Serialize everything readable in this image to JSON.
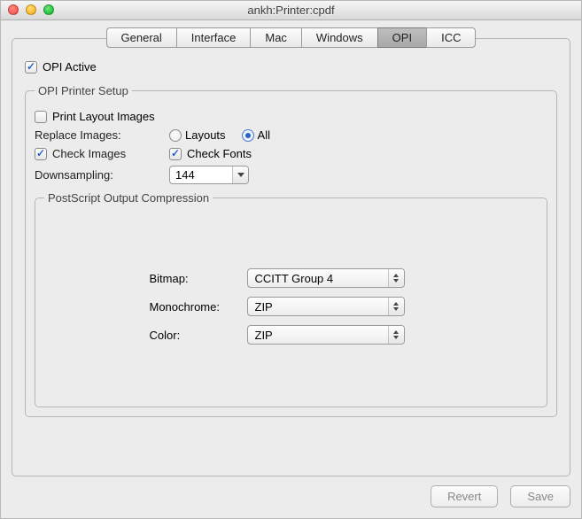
{
  "window": {
    "title": "ankh:Printer:cpdf"
  },
  "tabs": [
    {
      "label": "General",
      "active": false
    },
    {
      "label": "Interface",
      "active": false
    },
    {
      "label": "Mac",
      "active": false
    },
    {
      "label": "Windows",
      "active": false
    },
    {
      "label": "OPI",
      "active": true
    },
    {
      "label": "ICC",
      "active": false
    }
  ],
  "opi": {
    "active_label": "OPI Active",
    "active_checked": true,
    "setup_legend": "OPI Printer Setup",
    "print_layout_images_label": "Print Layout Images",
    "print_layout_images_checked": false,
    "replace_images_label": "Replace Images:",
    "replace_layouts_label": "Layouts",
    "replace_all_label": "All",
    "replace_selected": "all",
    "check_images_label": "Check Images",
    "check_images_checked": true,
    "check_fonts_label": "Check Fonts",
    "check_fonts_checked": true,
    "downsampling_label": "Downsampling:",
    "downsampling_value": "144"
  },
  "ps": {
    "legend": "PostScript Output Compression",
    "bitmap_label": "Bitmap:",
    "bitmap_value": "CCITT Group 4",
    "mono_label": "Monochrome:",
    "mono_value": "ZIP",
    "color_label": "Color:",
    "color_value": "ZIP"
  },
  "footer": {
    "revert_label": "Revert",
    "save_label": "Save"
  }
}
